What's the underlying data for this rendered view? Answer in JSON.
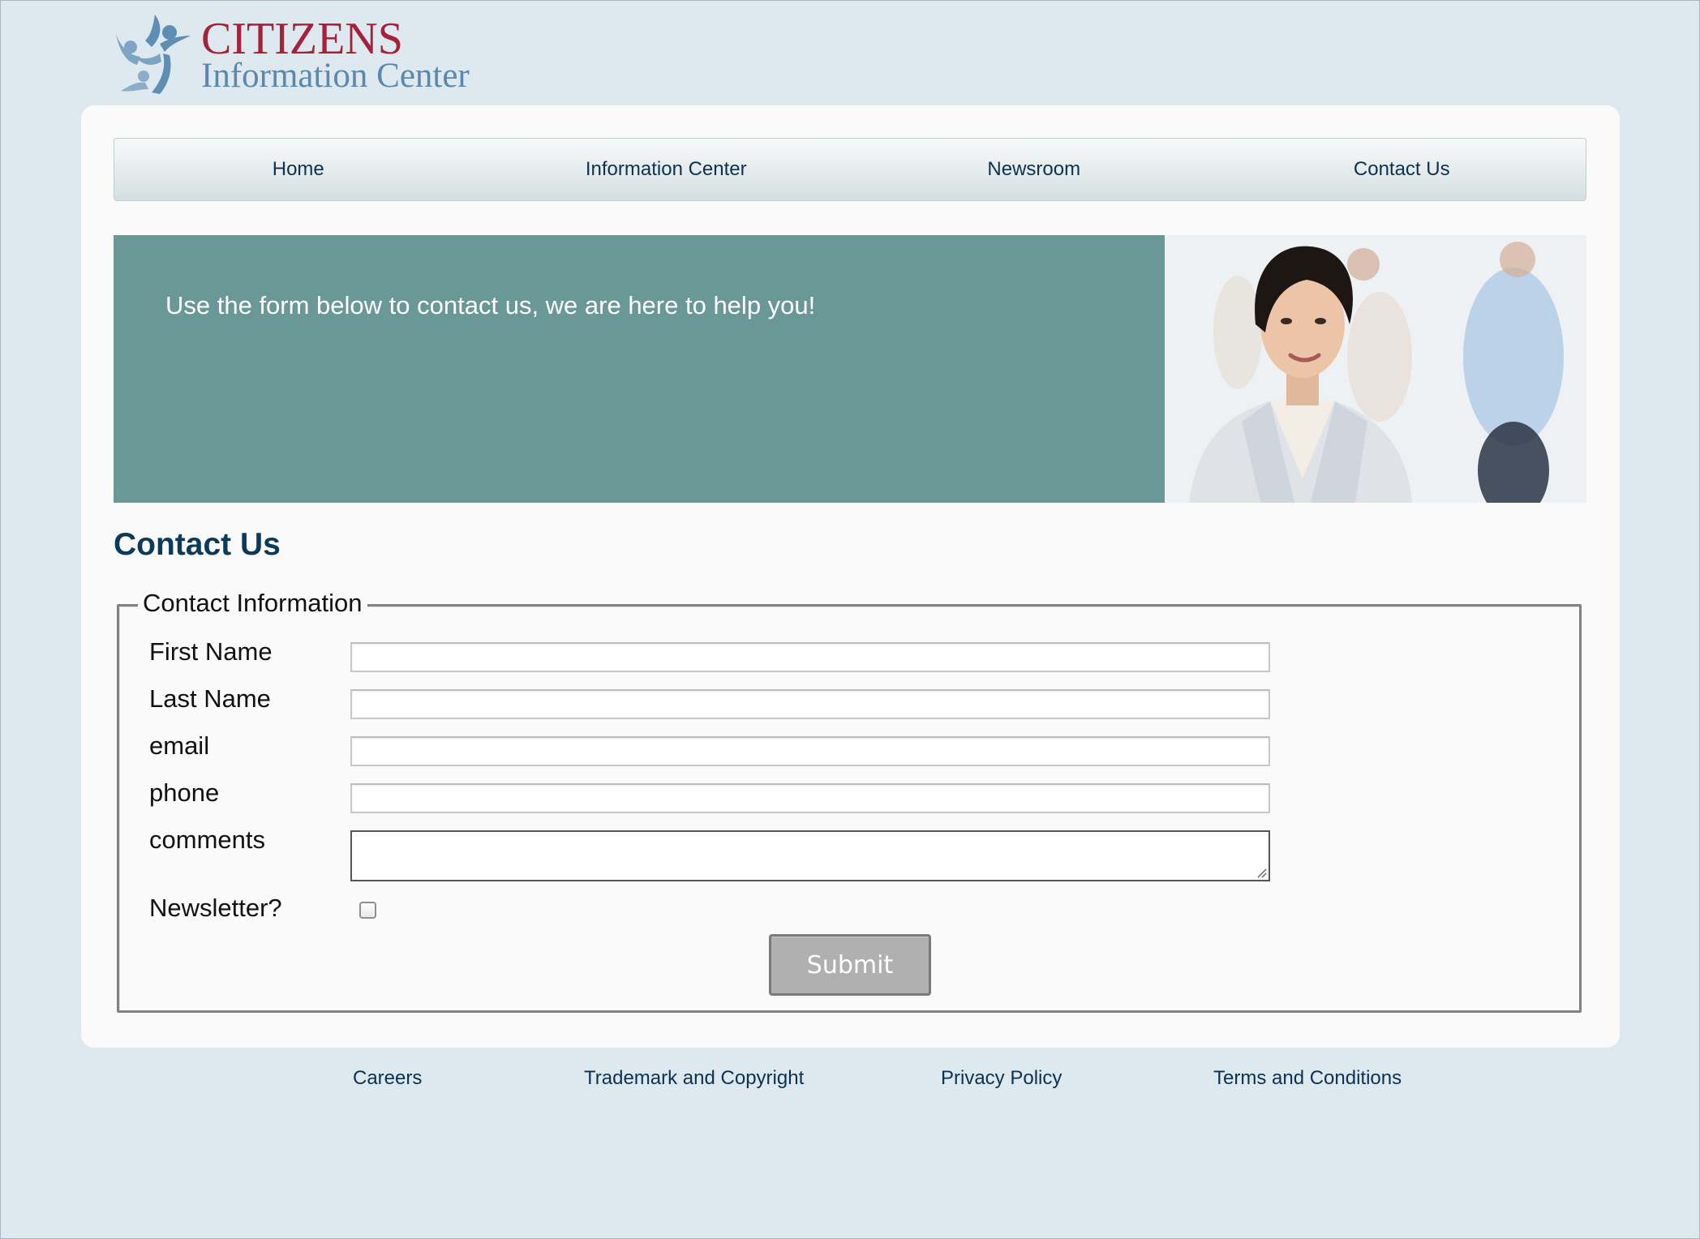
{
  "logo": {
    "title": "CITIZENS",
    "subtitle": "Information Center",
    "colors": {
      "title": "#a5223a",
      "subtitle": "#5d88ad",
      "mark": "#5f8eb4"
    }
  },
  "nav": {
    "items": [
      "Home",
      "Information Center",
      "Newsroom",
      "Contact Us"
    ]
  },
  "hero": {
    "text": "Use the form below to contact us, we are here to help you!",
    "background": "#6a9897"
  },
  "page": {
    "heading": "Contact Us"
  },
  "form": {
    "legend": "Contact Information",
    "fields": {
      "first_name": {
        "label": "First Name",
        "value": ""
      },
      "last_name": {
        "label": "Last Name",
        "value": ""
      },
      "email": {
        "label": "email",
        "value": ""
      },
      "phone": {
        "label": "phone",
        "value": ""
      },
      "comments": {
        "label": "comments",
        "value": ""
      },
      "newsletter": {
        "label": "Newsletter?",
        "checked": false
      }
    },
    "submit_label": "Submit"
  },
  "footer": {
    "links": [
      "Careers",
      "Trademark and Copyright",
      "Privacy Policy",
      "Terms and Conditions"
    ]
  }
}
